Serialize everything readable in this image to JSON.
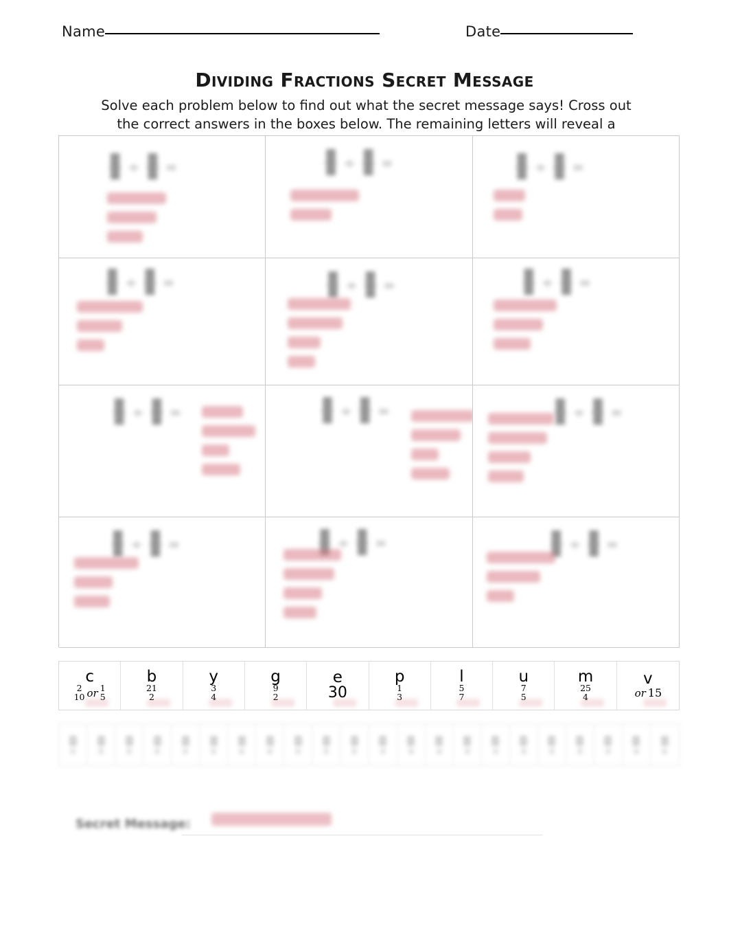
{
  "header": {
    "name_label": "Name",
    "date_label": "Date"
  },
  "title": "Dividing Fractions Secret Message",
  "instructions": "Solve each problem below to find out what the secret message says! Cross out the correct answers in the boxes below. The remaining letters will reveal a message.",
  "problem_grid": {
    "rows": 4,
    "columns": 3,
    "note": "problem expressions and red worked solutions are blurred/redacted in the screenshot",
    "cells": [
      {
        "id": "problem-1",
        "expression_redacted": true,
        "solution_lines": 3
      },
      {
        "id": "problem-2",
        "expression_redacted": true,
        "solution_lines": 2
      },
      {
        "id": "problem-3",
        "expression_redacted": true,
        "solution_lines": 2
      },
      {
        "id": "problem-4",
        "expression_redacted": true,
        "solution_lines": 3
      },
      {
        "id": "problem-5",
        "expression_redacted": true,
        "solution_lines": 4
      },
      {
        "id": "problem-6",
        "expression_redacted": true,
        "solution_lines": 3
      },
      {
        "id": "problem-7",
        "expression_redacted": true,
        "solution_lines": 4
      },
      {
        "id": "problem-8",
        "expression_redacted": true,
        "solution_lines": 4
      },
      {
        "id": "problem-9",
        "expression_redacted": true,
        "solution_lines": 4
      },
      {
        "id": "problem-10",
        "expression_redacted": true,
        "solution_lines": 3
      },
      {
        "id": "problem-11",
        "expression_redacted": true,
        "solution_lines": 4
      },
      {
        "id": "problem-12",
        "expression_redacted": true,
        "solution_lines": 3
      }
    ]
  },
  "answer_bank": {
    "items": [
      {
        "letter": "c",
        "value_type": "fraction_or_fraction",
        "num": "2",
        "den": "10",
        "or_label": "or",
        "alt_num": "1",
        "alt_den": "5"
      },
      {
        "letter": "b",
        "value_type": "fraction",
        "num": "21",
        "den": "2"
      },
      {
        "letter": "y",
        "value_type": "fraction",
        "num": "3",
        "den": "4"
      },
      {
        "letter": "g",
        "value_type": "fraction",
        "num": "9",
        "den": "2"
      },
      {
        "letter": "e",
        "value_type": "whole",
        "whole": "30"
      },
      {
        "letter": "p",
        "value_type": "fraction",
        "num": "1",
        "den": "3"
      },
      {
        "letter": "l",
        "value_type": "fraction",
        "num": "5",
        "den": "7"
      },
      {
        "letter": "u",
        "value_type": "fraction",
        "num": "7",
        "den": "5"
      },
      {
        "letter": "m",
        "value_type": "fraction",
        "num": "25",
        "den": "4"
      },
      {
        "letter": "v",
        "value_type": "or_only",
        "or_label": "or",
        "alt_plain": "15"
      }
    ]
  },
  "answer_bank_row_2": {
    "redacted": true,
    "cell_count": 22
  },
  "secret_message": {
    "label": "Secret Message:",
    "answer_redacted": true
  },
  "colors": {
    "grid_border": "#c9c9c9",
    "bank_border": "#d8d8d8",
    "solution_red": "#d4737f",
    "text": "#1a1a1a"
  }
}
